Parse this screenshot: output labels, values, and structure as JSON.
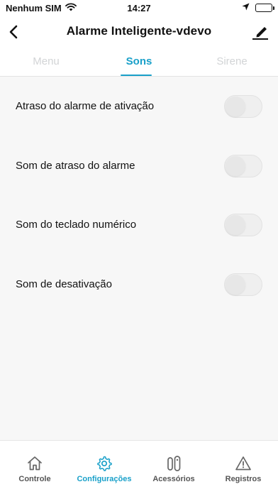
{
  "status_bar": {
    "carrier": "Nenhum SIM",
    "time": "14:27"
  },
  "header": {
    "title": "Alarme Inteligente-vdevo"
  },
  "tabs": [
    {
      "label": "Menu",
      "active": false
    },
    {
      "label": "Sons",
      "active": true
    },
    {
      "label": "Sirene",
      "active": false
    }
  ],
  "settings": [
    {
      "label": "Atraso do alarme de ativação",
      "enabled": false
    },
    {
      "label": "Som de atraso do alarme",
      "enabled": false
    },
    {
      "label": "Som do teclado numérico",
      "enabled": false
    },
    {
      "label": "Som de desativação",
      "enabled": false
    }
  ],
  "bottom_nav": [
    {
      "label": "Controle",
      "icon": "home-icon",
      "active": false
    },
    {
      "label": "Configurações",
      "icon": "gear-icon",
      "active": true
    },
    {
      "label": "Acessórios",
      "icon": "sensor-icon",
      "active": false
    },
    {
      "label": "Registros",
      "icon": "warning-icon",
      "active": false
    }
  ],
  "colors": {
    "accent": "#19a0c9",
    "inactive_tab": "#d2d4d6",
    "background": "#f7f7f7"
  }
}
